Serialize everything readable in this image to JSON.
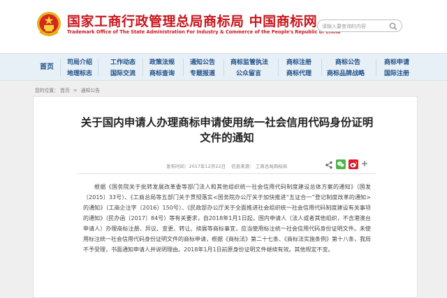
{
  "header": {
    "site_title": "国家工商行政管理总局商标局  中国商标网",
    "site_subtitle": "Trademark Office of The State Administration For Industry & Commerce of the People's Republic of China",
    "search_placeholder": "请输入要查询的内容"
  },
  "nav": {
    "home": "首页",
    "columns": [
      {
        "top": "司局介绍",
        "bottom": "地理标志"
      },
      {
        "top": "工作动态",
        "bottom": "国际交流"
      },
      {
        "top": "政策法规",
        "bottom": "商标查询"
      },
      {
        "top": "通知公告",
        "bottom": "专题报道"
      },
      {
        "top": "商标监管执法",
        "bottom": "公众留言"
      },
      {
        "top": "商标注册",
        "bottom": "商标代理"
      },
      {
        "top": "商标公告",
        "bottom": "商标品牌战略"
      },
      {
        "top": "商标申请",
        "bottom": "国际注册"
      }
    ]
  },
  "breadcrumb": {
    "prefix": "您的位置：",
    "home": "首页",
    "sep": ">",
    "current": "通知公告"
  },
  "article": {
    "title": "关于国内申请人办理商标申请使用统一社会信用代码身份证明文件的通知",
    "date_label": "发布时间：2017年12月22日",
    "source_label": "信息来源：",
    "source": "工商总局商标局",
    "body": "根据《国务院关于批转发展改革委等部门法人和其他组织统一社会信用代码制度建设总体方案的通知》（国发〔2015〕33号）、《工商总局等五部门关于贯彻落实<国务院办公厅关于加快推进“五证合一”登记制度改革的通知>的通知》（工商企注字〔2016〕150号）、《民政部办公厅关于全面推进社会组织统一社会信用代码制度建设有关事项的通知》（民办函〔2017〕84号）等有关要求，自2018年1月1日起，国内申请人（法人或者其他组织，不含港澳台申请人）办理商标注册、异议、变更、转让、续展等商标事宜，应当使用标注统一社会信用代码身份证明文件。未使用标注统一社会信用代码身份证明文件的商标申请，根据《商标法》第二十七条、《商标法实施条例》第十八条，我局不予受理，书面通知申请人并说明理由。2018年1月1日前原身份证明文件继续有效。其他规定不变。"
  },
  "colors": {
    "brand_red": "#c8161d",
    "nav_blue": "#1f4e87",
    "nav_bg": "#e7f0f7",
    "wechat_green": "#4cb648",
    "weibo_red": "#e6162d"
  }
}
